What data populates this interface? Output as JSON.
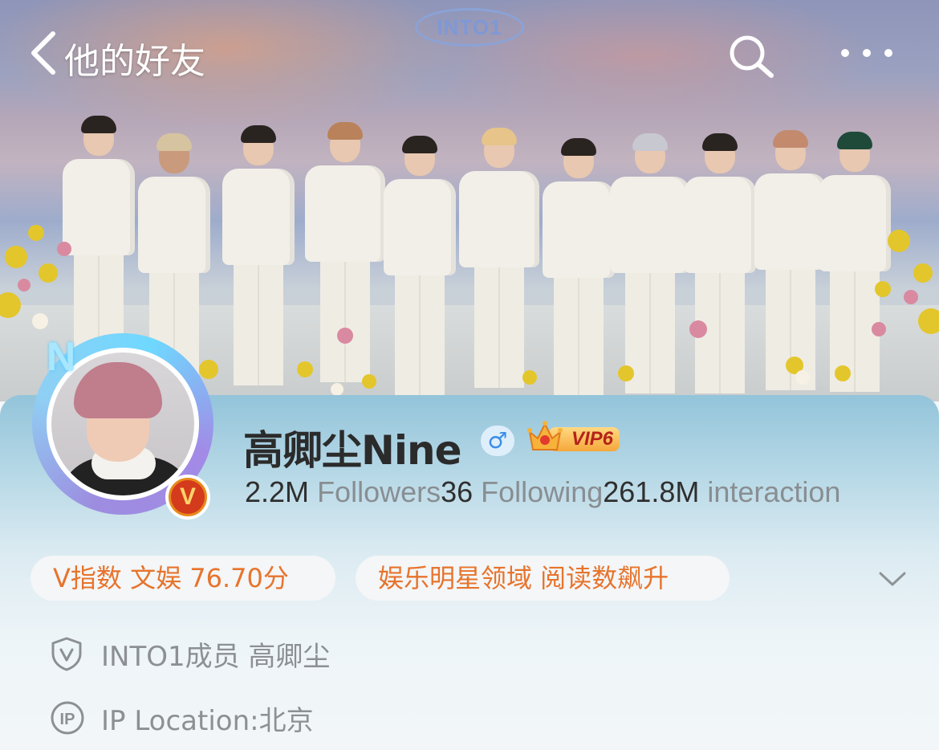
{
  "header": {
    "back_icon": "chevron-left-icon",
    "title": "他的好友",
    "search_icon": "search-icon",
    "more_icon": "more-horizontal-icon"
  },
  "banner": {
    "logo_text": "INTO1"
  },
  "profile": {
    "avatar_letter": "N",
    "verified_badge": "V",
    "name": "高卿尘Nine",
    "gender_symbol": "♂",
    "vip_label": "VIP6",
    "stats": {
      "followers_value": "2.2M",
      "followers_label": "Followers",
      "following_value": "36",
      "following_label": "Following",
      "interaction_value": "261.8M",
      "interaction_label": "interaction"
    },
    "chips": [
      {
        "label": "V指数 文娱 76.70分"
      },
      {
        "label": "娱乐明星领域 阅读数飙升"
      }
    ],
    "expand_icon": "chevron-down-icon",
    "info": [
      {
        "icon": "shield-v-icon",
        "text": "INTO1成员 高卿尘"
      },
      {
        "icon": "ip-icon",
        "text": "IP Location:北京"
      }
    ]
  },
  "colors": {
    "accent_orange": "#e7742d",
    "stat_label_gray": "#888e92",
    "card_top_blue": "#93c4da"
  }
}
